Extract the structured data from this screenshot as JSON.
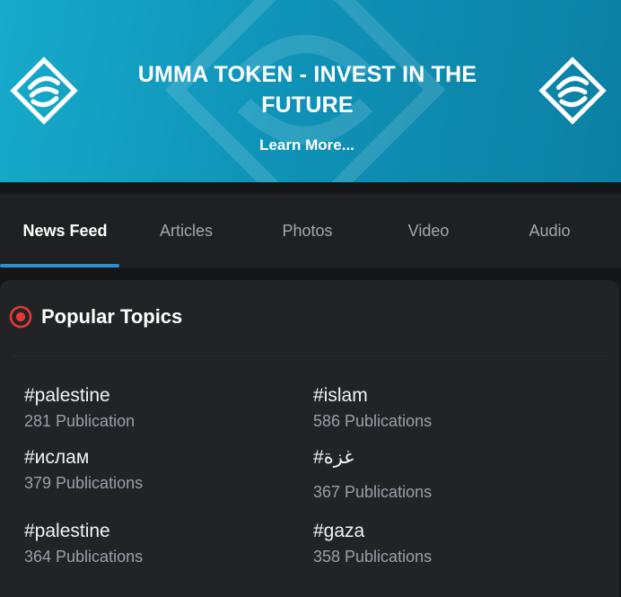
{
  "banner": {
    "title": "UMMA TOKEN - INVEST IN THE FUTURE",
    "link": "Learn More...",
    "colors": {
      "start": "#17aacb",
      "end": "#0c7fa4"
    }
  },
  "tabs": [
    {
      "label": "News Feed",
      "active": true
    },
    {
      "label": "Articles",
      "active": false
    },
    {
      "label": "Photos",
      "active": false
    },
    {
      "label": "Video",
      "active": false
    },
    {
      "label": "Audio",
      "active": false
    }
  ],
  "topics_card": {
    "title": "Popular Topics",
    "icon": "radio-target-icon",
    "accent": "#e53935",
    "items": [
      {
        "tag": "#palestine",
        "count": "281 Publication"
      },
      {
        "tag": "#islam",
        "count": "586 Publications"
      },
      {
        "tag": "#ислам",
        "count": "379 Publications"
      },
      {
        "tag": "#غزة",
        "count": "367 Publications"
      },
      {
        "tag": "#palestine",
        "count": "364 Publications"
      },
      {
        "tag": "#gaza",
        "count": "358 Publications"
      }
    ]
  }
}
